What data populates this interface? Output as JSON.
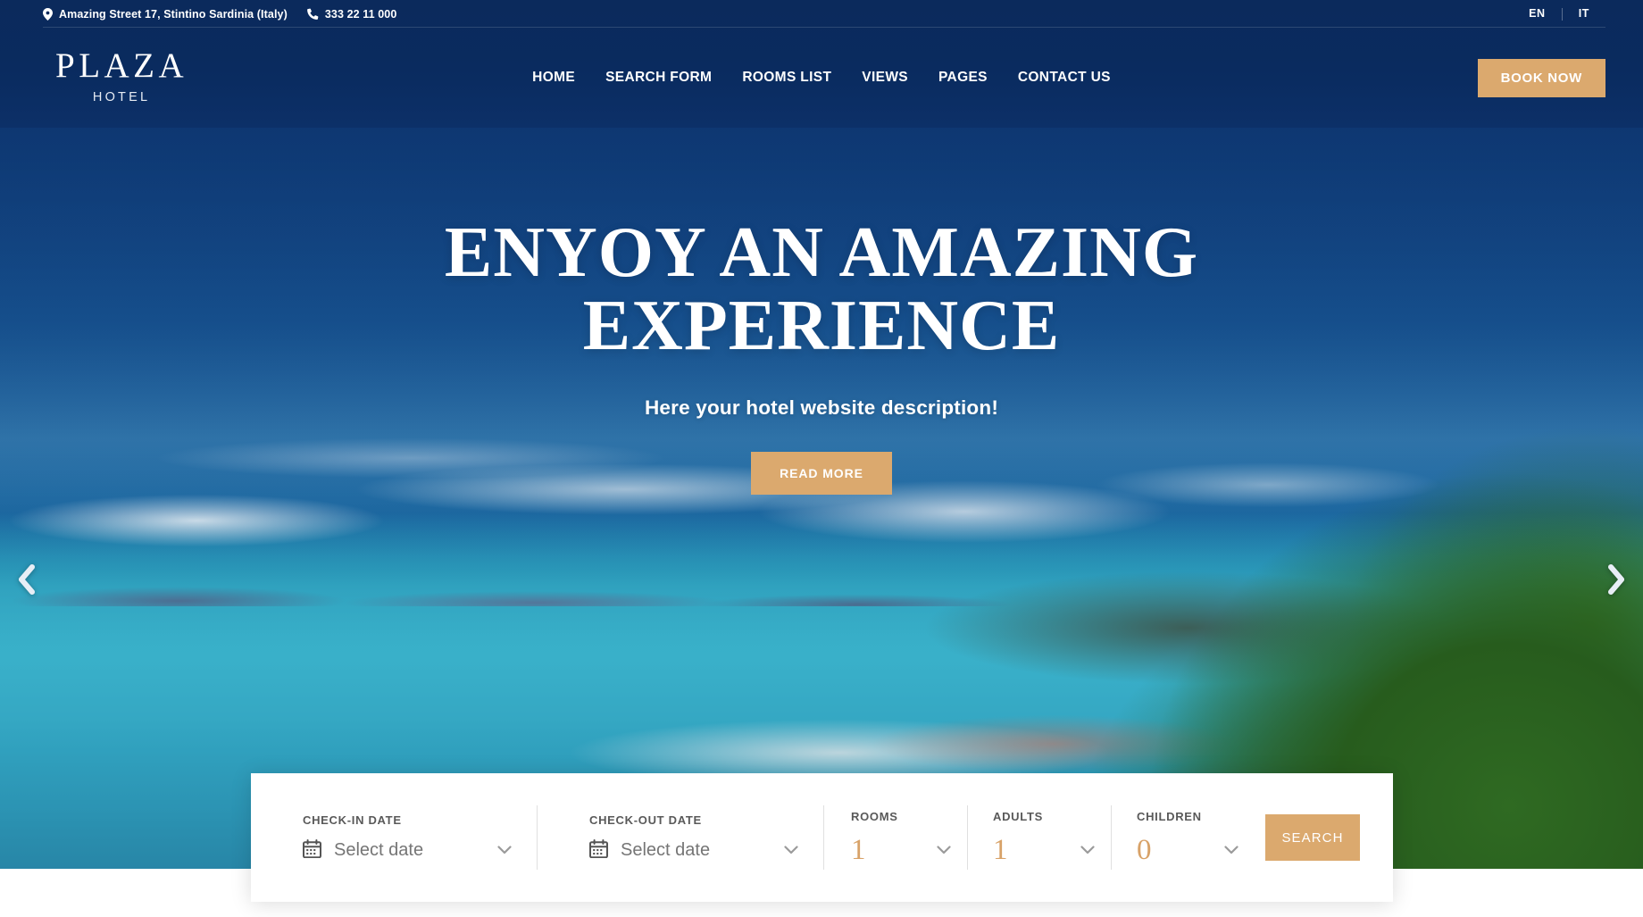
{
  "topbar": {
    "address": "Amazing Street 17, Stintino Sardinia (Italy)",
    "phone": "333 22 11 000",
    "languages": [
      {
        "code": "EN"
      },
      {
        "code": "IT"
      }
    ]
  },
  "header": {
    "logo_main": "PLAZA",
    "logo_sub": "HOTEL",
    "nav": [
      {
        "label": "HOME"
      },
      {
        "label": "SEARCH FORM"
      },
      {
        "label": "ROOMS LIST"
      },
      {
        "label": "VIEWS"
      },
      {
        "label": "PAGES"
      },
      {
        "label": "CONTACT US"
      }
    ],
    "book_now_label": "BOOK NOW",
    "accent_color": "#dba96e",
    "background_color": "#0b2a5c"
  },
  "hero": {
    "title_line1": "ENYOY AN AMAZING",
    "title_line2": "EXPERIENCE",
    "subtitle": "Here your hotel website description!",
    "read_more_label": "READ MORE",
    "prev_arrow_name": "chevron-left-icon",
    "next_arrow_name": "chevron-right-icon"
  },
  "search_bar": {
    "checkin": {
      "label": "CHECK-IN DATE",
      "value": "Select date",
      "placeholder": "Select date"
    },
    "checkout": {
      "label": "CHECK-OUT DATE",
      "value": "Select date",
      "placeholder": "Select date"
    },
    "rooms": {
      "label": "ROOMS",
      "value": "1"
    },
    "adults": {
      "label": "ADULTS",
      "value": "1"
    },
    "children": {
      "label": "CHILDREN",
      "value": "0"
    },
    "search_label": "SEARCH",
    "number_color": "#d8a268"
  }
}
